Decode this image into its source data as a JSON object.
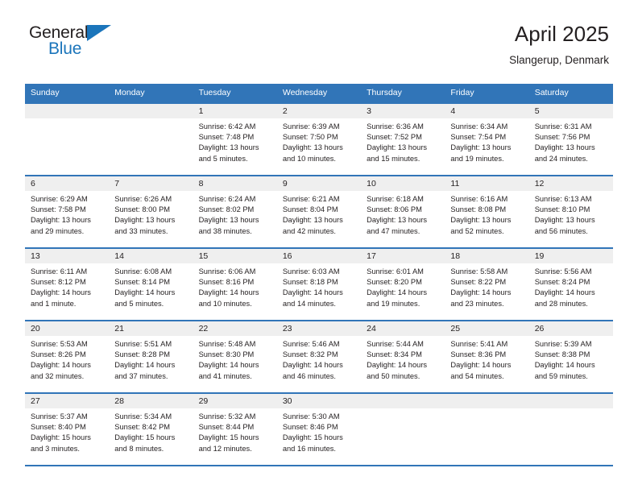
{
  "brand": {
    "name_part1": "General",
    "name_part2": "Blue",
    "triangle_icon": "triangle-icon",
    "accent_color": "#1b75bb"
  },
  "header": {
    "title": "April 2025",
    "subtitle": "Slangerup, Denmark"
  },
  "theme": {
    "header_blue": "#3175b8",
    "daynum_band": "#efefef",
    "text": "#231f20"
  },
  "weekdays": [
    "Sunday",
    "Monday",
    "Tuesday",
    "Wednesday",
    "Thursday",
    "Friday",
    "Saturday"
  ],
  "labels": {
    "sunrise": "Sunrise:",
    "sunset": "Sunset:",
    "daylight": "Daylight:"
  },
  "weeks": [
    [
      {
        "day": "",
        "empty": true
      },
      {
        "day": "",
        "empty": true
      },
      {
        "day": "1",
        "sunrise": "Sunrise: 6:42 AM",
        "sunset": "Sunset: 7:48 PM",
        "daylight": "Daylight: 13 hours and 5 minutes."
      },
      {
        "day": "2",
        "sunrise": "Sunrise: 6:39 AM",
        "sunset": "Sunset: 7:50 PM",
        "daylight": "Daylight: 13 hours and 10 minutes."
      },
      {
        "day": "3",
        "sunrise": "Sunrise: 6:36 AM",
        "sunset": "Sunset: 7:52 PM",
        "daylight": "Daylight: 13 hours and 15 minutes."
      },
      {
        "day": "4",
        "sunrise": "Sunrise: 6:34 AM",
        "sunset": "Sunset: 7:54 PM",
        "daylight": "Daylight: 13 hours and 19 minutes."
      },
      {
        "day": "5",
        "sunrise": "Sunrise: 6:31 AM",
        "sunset": "Sunset: 7:56 PM",
        "daylight": "Daylight: 13 hours and 24 minutes."
      }
    ],
    [
      {
        "day": "6",
        "sunrise": "Sunrise: 6:29 AM",
        "sunset": "Sunset: 7:58 PM",
        "daylight": "Daylight: 13 hours and 29 minutes."
      },
      {
        "day": "7",
        "sunrise": "Sunrise: 6:26 AM",
        "sunset": "Sunset: 8:00 PM",
        "daylight": "Daylight: 13 hours and 33 minutes."
      },
      {
        "day": "8",
        "sunrise": "Sunrise: 6:24 AM",
        "sunset": "Sunset: 8:02 PM",
        "daylight": "Daylight: 13 hours and 38 minutes."
      },
      {
        "day": "9",
        "sunrise": "Sunrise: 6:21 AM",
        "sunset": "Sunset: 8:04 PM",
        "daylight": "Daylight: 13 hours and 42 minutes."
      },
      {
        "day": "10",
        "sunrise": "Sunrise: 6:18 AM",
        "sunset": "Sunset: 8:06 PM",
        "daylight": "Daylight: 13 hours and 47 minutes."
      },
      {
        "day": "11",
        "sunrise": "Sunrise: 6:16 AM",
        "sunset": "Sunset: 8:08 PM",
        "daylight": "Daylight: 13 hours and 52 minutes."
      },
      {
        "day": "12",
        "sunrise": "Sunrise: 6:13 AM",
        "sunset": "Sunset: 8:10 PM",
        "daylight": "Daylight: 13 hours and 56 minutes."
      }
    ],
    [
      {
        "day": "13",
        "sunrise": "Sunrise: 6:11 AM",
        "sunset": "Sunset: 8:12 PM",
        "daylight": "Daylight: 14 hours and 1 minute."
      },
      {
        "day": "14",
        "sunrise": "Sunrise: 6:08 AM",
        "sunset": "Sunset: 8:14 PM",
        "daylight": "Daylight: 14 hours and 5 minutes."
      },
      {
        "day": "15",
        "sunrise": "Sunrise: 6:06 AM",
        "sunset": "Sunset: 8:16 PM",
        "daylight": "Daylight: 14 hours and 10 minutes."
      },
      {
        "day": "16",
        "sunrise": "Sunrise: 6:03 AM",
        "sunset": "Sunset: 8:18 PM",
        "daylight": "Daylight: 14 hours and 14 minutes."
      },
      {
        "day": "17",
        "sunrise": "Sunrise: 6:01 AM",
        "sunset": "Sunset: 8:20 PM",
        "daylight": "Daylight: 14 hours and 19 minutes."
      },
      {
        "day": "18",
        "sunrise": "Sunrise: 5:58 AM",
        "sunset": "Sunset: 8:22 PM",
        "daylight": "Daylight: 14 hours and 23 minutes."
      },
      {
        "day": "19",
        "sunrise": "Sunrise: 5:56 AM",
        "sunset": "Sunset: 8:24 PM",
        "daylight": "Daylight: 14 hours and 28 minutes."
      }
    ],
    [
      {
        "day": "20",
        "sunrise": "Sunrise: 5:53 AM",
        "sunset": "Sunset: 8:26 PM",
        "daylight": "Daylight: 14 hours and 32 minutes."
      },
      {
        "day": "21",
        "sunrise": "Sunrise: 5:51 AM",
        "sunset": "Sunset: 8:28 PM",
        "daylight": "Daylight: 14 hours and 37 minutes."
      },
      {
        "day": "22",
        "sunrise": "Sunrise: 5:48 AM",
        "sunset": "Sunset: 8:30 PM",
        "daylight": "Daylight: 14 hours and 41 minutes."
      },
      {
        "day": "23",
        "sunrise": "Sunrise: 5:46 AM",
        "sunset": "Sunset: 8:32 PM",
        "daylight": "Daylight: 14 hours and 46 minutes."
      },
      {
        "day": "24",
        "sunrise": "Sunrise: 5:44 AM",
        "sunset": "Sunset: 8:34 PM",
        "daylight": "Daylight: 14 hours and 50 minutes."
      },
      {
        "day": "25",
        "sunrise": "Sunrise: 5:41 AM",
        "sunset": "Sunset: 8:36 PM",
        "daylight": "Daylight: 14 hours and 54 minutes."
      },
      {
        "day": "26",
        "sunrise": "Sunrise: 5:39 AM",
        "sunset": "Sunset: 8:38 PM",
        "daylight": "Daylight: 14 hours and 59 minutes."
      }
    ],
    [
      {
        "day": "27",
        "sunrise": "Sunrise: 5:37 AM",
        "sunset": "Sunset: 8:40 PM",
        "daylight": "Daylight: 15 hours and 3 minutes."
      },
      {
        "day": "28",
        "sunrise": "Sunrise: 5:34 AM",
        "sunset": "Sunset: 8:42 PM",
        "daylight": "Daylight: 15 hours and 8 minutes."
      },
      {
        "day": "29",
        "sunrise": "Sunrise: 5:32 AM",
        "sunset": "Sunset: 8:44 PM",
        "daylight": "Daylight: 15 hours and 12 minutes."
      },
      {
        "day": "30",
        "sunrise": "Sunrise: 5:30 AM",
        "sunset": "Sunset: 8:46 PM",
        "daylight": "Daylight: 15 hours and 16 minutes."
      },
      {
        "day": "",
        "empty": true
      },
      {
        "day": "",
        "empty": true
      },
      {
        "day": "",
        "empty": true
      }
    ]
  ]
}
